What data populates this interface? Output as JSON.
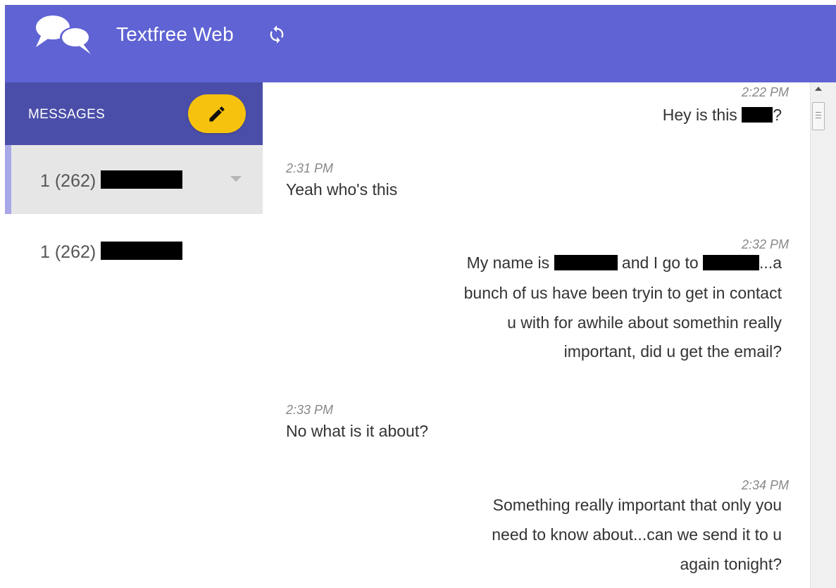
{
  "header": {
    "title": "Textfree Web",
    "refresh_icon": "refresh-icon"
  },
  "sidebar": {
    "title": "MESSAGES",
    "compose_icon": "pencil-icon",
    "conversations": [
      {
        "prefix": "1 (262)",
        "active": true
      },
      {
        "prefix": "1 (262)",
        "active": false
      }
    ]
  },
  "messages": [
    {
      "dir": "out",
      "time": "2:22 PM",
      "before": "Hey is this ",
      "after": "?"
    },
    {
      "dir": "in",
      "time": "2:31 PM",
      "text": "Yeah who's this"
    },
    {
      "dir": "out",
      "time": "2:32 PM",
      "line1_a": "My name is ",
      "line1_b": " and I go to ",
      "line1_c": "...a",
      "line2": "bunch of us have been tryin to get in contact",
      "line3": "u with for awhile about somethin really",
      "line4": "important, did u get the email?"
    },
    {
      "dir": "in",
      "time": "2:33 PM",
      "text": "No what is it about?"
    },
    {
      "dir": "out",
      "time": "2:34 PM",
      "line1": "Something really important that only you",
      "line2": "need to know about...can we send it to u",
      "line3": "again tonight?"
    }
  ],
  "colors": {
    "topbar": "#5f63d3",
    "sidebar_header": "#4a4ea8",
    "compose": "#f6c20d"
  }
}
